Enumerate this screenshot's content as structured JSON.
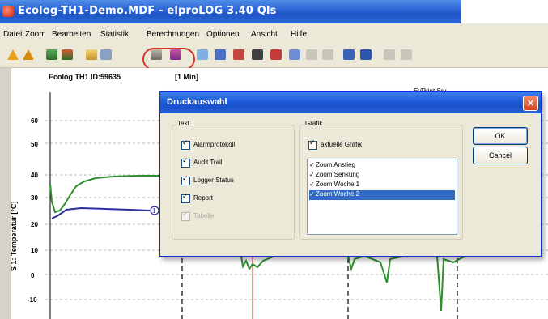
{
  "window": {
    "title": "Ecolog-TH1-Demo.MDF - elproLOG 3.40 Qls"
  },
  "menu": {
    "items": [
      "Datei",
      "Zoom",
      "Bearbeiten",
      "Statistik",
      "Berechnungen",
      "Optionen",
      "Ansicht",
      "Hilfe"
    ]
  },
  "toolbar": {
    "icons": [
      "warning-icon",
      "warning-icon",
      "logger-icon",
      "logger-icon",
      "open-folder-icon",
      "save-icon",
      "print-icon",
      "print-preview-icon",
      "chart-icon",
      "table-icon",
      "help-icon",
      "document-icon",
      "export-icon",
      "search-icon",
      "copy-icon",
      "cut-icon",
      "download-icon",
      "upload-icon",
      "arrow-icon",
      "arrow-icon"
    ],
    "highlight_color": "#d9302c"
  },
  "chart": {
    "header_left": "Ecolog TH1 ID:59635",
    "header_interval": "[1 Min]",
    "print_server": "E:/Print Srv",
    "y_axis_label": "S 1: Temperatur [°C]",
    "y_ticks": [
      "60",
      "50",
      "40",
      "30",
      "20",
      "10",
      "0",
      "-10"
    ],
    "marker_label": "1"
  },
  "chart_data": {
    "type": "line",
    "ylabel": "S 1: Temperatur [°C]",
    "ylim": [
      -12,
      66
    ],
    "series": [
      {
        "color": "#2f8f2f",
        "values": [
          18,
          30,
          35,
          37,
          38,
          38.5,
          38.5,
          38.5,
          38
        ]
      },
      {
        "color": "#2b2f9c",
        "values": [
          25,
          23,
          24,
          24,
          23.5,
          24,
          24,
          24
        ]
      }
    ]
  },
  "dialog": {
    "title": "Druckauswahl",
    "close": "×",
    "text_group": {
      "label": "Text",
      "items": [
        {
          "label": "Alarmprotokoll",
          "checked": true,
          "enabled": true
        },
        {
          "label": "Audit Trail",
          "checked": true,
          "enabled": true
        },
        {
          "label": "Logger Status",
          "checked": true,
          "enabled": true
        },
        {
          "label": "Report",
          "checked": true,
          "enabled": true
        },
        {
          "label": "Tabelle",
          "checked": false,
          "enabled": false
        }
      ]
    },
    "graphic_group": {
      "label": "Grafik",
      "current": {
        "label": "aktuelle Grafik",
        "checked": true
      },
      "zooms": [
        {
          "label": "Zoom Anstieg",
          "checked": true,
          "selected": false
        },
        {
          "label": "Zoom Senkung",
          "checked": true,
          "selected": false
        },
        {
          "label": "Zoom Woche 1",
          "checked": true,
          "selected": false
        },
        {
          "label": "Zoom Woche 2",
          "checked": true,
          "selected": true
        }
      ]
    },
    "ok": "OK",
    "cancel": "Cancel"
  }
}
